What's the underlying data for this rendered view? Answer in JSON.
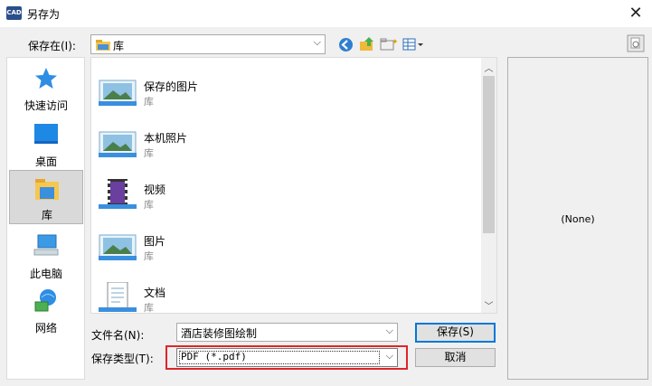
{
  "window": {
    "app_icon_text": "CAD",
    "title": "另存为",
    "close_glyph": "✕"
  },
  "location": {
    "label": "保存在(I):",
    "value": "库"
  },
  "places": [
    {
      "label": "快速访问",
      "icon": "star-icon"
    },
    {
      "label": "桌面",
      "icon": "desktop-icon"
    },
    {
      "label": "库",
      "icon": "library-icon",
      "selected": true
    },
    {
      "label": "此电脑",
      "icon": "computer-icon"
    },
    {
      "label": "网络",
      "icon": "network-icon"
    }
  ],
  "files": [
    {
      "name": "保存的图片",
      "type": "库",
      "icon": "picture-library-icon"
    },
    {
      "name": "本机照片",
      "type": "库",
      "icon": "picture-library-icon"
    },
    {
      "name": "视频",
      "type": "库",
      "icon": "video-library-icon"
    },
    {
      "name": "图片",
      "type": "库",
      "icon": "picture-library-icon"
    },
    {
      "name": "文档",
      "type": "库",
      "icon": "document-library-icon"
    }
  ],
  "preview": {
    "text": "(None)"
  },
  "filename": {
    "label": "文件名(N):",
    "value": "酒店装修图绘制"
  },
  "filetype": {
    "label": "保存类型(T):",
    "value": "PDF (*.pdf)"
  },
  "buttons": {
    "save": "保存(S)",
    "cancel": "取消"
  },
  "colors": {
    "highlight_box": "#e0242a",
    "selection": "#d9d9d9",
    "accent": "#0078d7"
  }
}
